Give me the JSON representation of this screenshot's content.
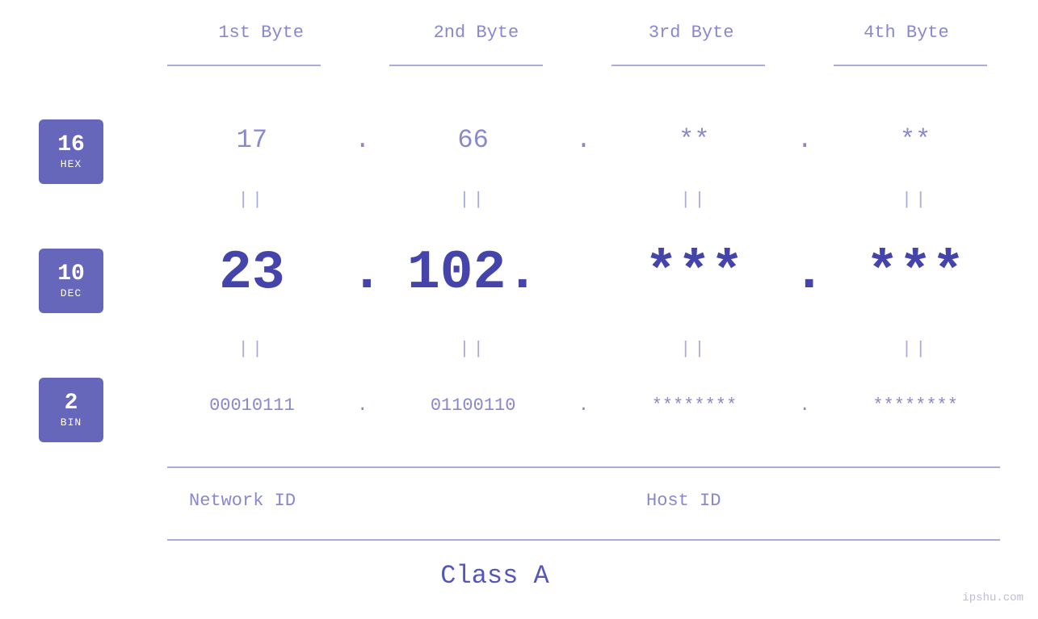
{
  "byteLabels": [
    "1st Byte",
    "2nd Byte",
    "3rd Byte",
    "4th Byte"
  ],
  "badges": {
    "hex": {
      "num": "16",
      "label": "HEX"
    },
    "dec": {
      "num": "10",
      "label": "DEC"
    },
    "bin": {
      "num": "2",
      "label": "BIN"
    }
  },
  "hexRow": {
    "cells": [
      "17",
      "66",
      "**",
      "**"
    ],
    "dots": [
      ".",
      ".",
      "."
    ]
  },
  "decRow": {
    "cells": [
      "23",
      "102.",
      "***",
      "***"
    ],
    "dot1": ".",
    "dot2": ".",
    "dot3": "."
  },
  "binRow": {
    "cells": [
      "00010111",
      "01100110",
      "********",
      "********"
    ],
    "dots": [
      ".",
      ".",
      "."
    ]
  },
  "separators": {
    "symbol": "||"
  },
  "labels": {
    "networkId": "Network ID",
    "hostId": "Host ID",
    "classA": "Class A"
  },
  "watermark": "ipshu.com"
}
